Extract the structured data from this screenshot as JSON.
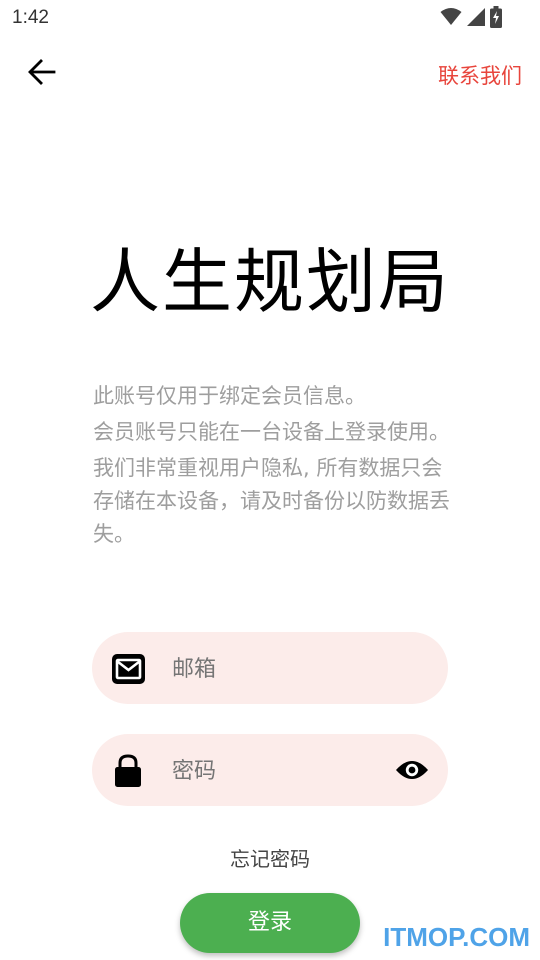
{
  "status_bar": {
    "time": "1:42",
    "icons": [
      "wifi-icon",
      "cell-signal-icon",
      "battery-charging-icon"
    ]
  },
  "toolbar": {
    "back_icon": "arrow-left-icon",
    "contact_label": "联系我们",
    "contact_color": "#e8453c"
  },
  "app": {
    "title": "人生规划局"
  },
  "info": {
    "lines": [
      "此账号仅用于绑定会员信息。",
      "会员账号只能在一台设备上登录使用。",
      "我们非常重视用户隐私, 所有数据只会存储在本设备，请及时备份以防数据丢失。"
    ]
  },
  "form": {
    "email": {
      "placeholder": "邮箱",
      "value": "",
      "icon": "mail-icon"
    },
    "password": {
      "placeholder": "密码",
      "value": "",
      "icon": "lock-icon",
      "toggle_icon": "eye-icon"
    },
    "field_bg_color": "#fcecea",
    "forgot_label": "忘记密码",
    "login_label": "登录",
    "login_color": "#4caf50"
  },
  "watermark": {
    "text": "ITMOP.COM"
  }
}
